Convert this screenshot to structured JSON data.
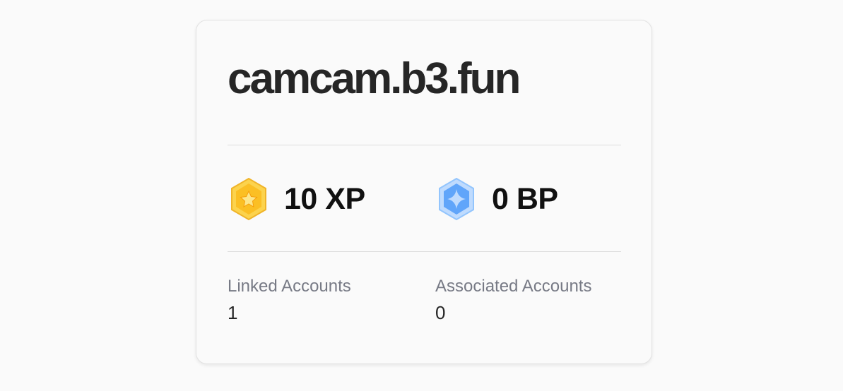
{
  "profile": {
    "name": "camcam.b3.fun"
  },
  "stats": {
    "xp": {
      "icon": "gold-star-hexagon-icon",
      "label": "10 XP",
      "color": "#fbbf24"
    },
    "bp": {
      "icon": "blue-sparkle-hexagon-icon",
      "label": "0 BP",
      "color": "#60a5fa"
    }
  },
  "accounts": {
    "linked": {
      "label": "Linked Accounts",
      "count": "1"
    },
    "associated": {
      "label": "Associated Accounts",
      "count": "0"
    }
  }
}
